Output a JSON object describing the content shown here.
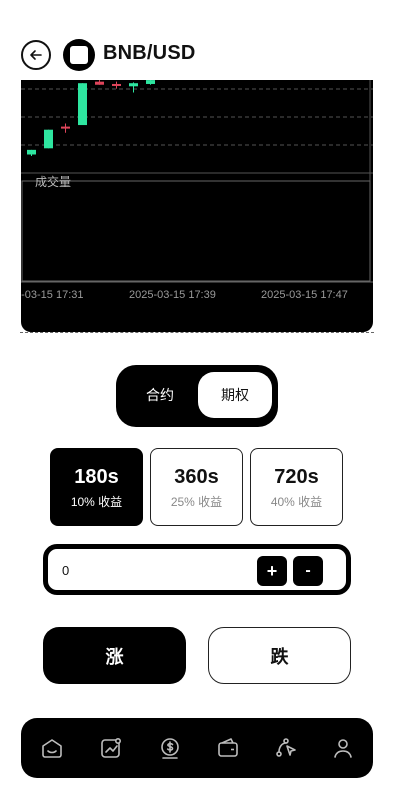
{
  "header": {
    "title": "BNB/USD",
    "back_icon": "arrow-left-icon",
    "coin_icon": "bnb-coin-icon"
  },
  "chart": {
    "volume_label": "成交量",
    "time_labels": [
      "5-03-15 17:31",
      "2025-03-15 17:39",
      "2025-03-15 17:47"
    ],
    "colors": {
      "up": "#2ee6a0",
      "down": "#e0455b",
      "background": "#000000"
    }
  },
  "chart_data": {
    "type": "candlestick",
    "x": [
      "17:29",
      "17:31",
      "17:33",
      "17:35",
      "17:37",
      "17:39",
      "17:41",
      "17:43",
      "17:45",
      "17:47"
    ],
    "candles": [
      {
        "open": 2.0,
        "close": 2.6,
        "high": 2.6,
        "low": 1.8,
        "dir": "up"
      },
      {
        "open": 2.8,
        "close": 5.2,
        "high": 5.2,
        "low": 2.8,
        "dir": "up"
      },
      {
        "open": 5.4,
        "close": 5.6,
        "high": 6.0,
        "low": 4.8,
        "dir": "down"
      },
      {
        "open": 5.8,
        "close": 11.2,
        "high": 11.2,
        "low": 5.8,
        "dir": "up"
      },
      {
        "open": 11.0,
        "close": 11.4,
        "high": 11.6,
        "low": 11.0,
        "dir": "down"
      },
      {
        "open": 10.9,
        "close": 11.1,
        "high": 11.4,
        "low": 10.5,
        "dir": "down"
      },
      {
        "open": 10.8,
        "close": 11.2,
        "high": 11.3,
        "low": 10.0,
        "dir": "up"
      },
      {
        "open": 11.1,
        "close": 11.6,
        "high": 11.7,
        "low": 11.0,
        "dir": "up"
      }
    ],
    "volume_label": "成交量"
  },
  "segment": {
    "items": [
      {
        "label": "合约",
        "active": false
      },
      {
        "label": "期权",
        "active": true
      }
    ]
  },
  "durations": [
    {
      "time": "180s",
      "yield": "10% 收益",
      "active": true
    },
    {
      "time": "360s",
      "yield": "25% 收益",
      "active": false
    },
    {
      "time": "720s",
      "yield": "40% 收益",
      "active": false
    }
  ],
  "amount": {
    "value": "0",
    "plus": "+",
    "minus": "-"
  },
  "actions": {
    "up_label": "涨",
    "down_label": "跌"
  },
  "nav": {
    "items": [
      "home-icon",
      "chart-trend-icon",
      "coin-dollar-icon",
      "wallet-icon",
      "share-network-icon",
      "user-icon"
    ]
  }
}
